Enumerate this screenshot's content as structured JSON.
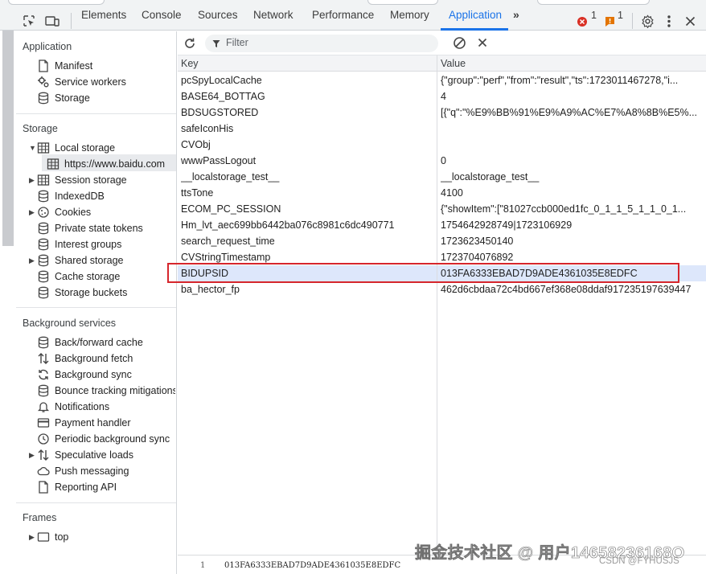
{
  "top_tabs": [
    "Elements",
    "Console",
    "Sources",
    "Network",
    "Performance",
    "Memory",
    "Application"
  ],
  "active_tab": "Application",
  "error_count": "1",
  "warning_count": "1",
  "toolbar": {
    "filter_placeholder": "Filter"
  },
  "sidebar": {
    "application_header": "Application",
    "application_items": [
      "Manifest",
      "Service workers",
      "Storage"
    ],
    "storage_header": "Storage",
    "storage_items": [
      "Local storage",
      "https://www.baidu.com",
      "Session storage",
      "IndexedDB",
      "Cookies",
      "Private state tokens",
      "Interest groups",
      "Shared storage",
      "Cache storage",
      "Storage buckets"
    ],
    "background_header": "Background services",
    "background_items": [
      "Back/forward cache",
      "Background fetch",
      "Background sync",
      "Bounce tracking mitigations",
      "Notifications",
      "Payment handler",
      "Periodic background sync",
      "Speculative loads",
      "Push messaging",
      "Reporting API"
    ],
    "frames_header": "Frames",
    "frames_items": [
      "top"
    ]
  },
  "table": {
    "key_header": "Key",
    "value_header": "Value",
    "rows": [
      {
        "key": "pcSpyLocalCache",
        "value": "{\"group\":\"perf\",\"from\":\"result\",\"ts\":1723011467278,\"i..."
      },
      {
        "key": "BASE64_BOTTAG",
        "value": "4"
      },
      {
        "key": "BDSUGSTORED",
        "value": "[{\"q\":\"%E9%BB%91%E9%A9%AC%E7%A8%8B%E5%..."
      },
      {
        "key": "safeIconHis",
        "value": ""
      },
      {
        "key": "CVObj",
        "value": ""
      },
      {
        "key": "wwwPassLogout",
        "value": "0"
      },
      {
        "key": "__localstorage_test__",
        "value": "__localstorage_test__"
      },
      {
        "key": "ttsTone",
        "value": "4100"
      },
      {
        "key": "ECOM_PC_SESSION",
        "value": "{\"showItem\":[\"81027ccb000ed1fc_0_1_1_5_1_1_0_1..."
      },
      {
        "key": "Hm_lvt_aec699bb6442ba076c8981c6dc490771",
        "value": "1754642928749|1723106929"
      },
      {
        "key": "search_request_time",
        "value": "1723623450140"
      },
      {
        "key": "CVStringTimestamp",
        "value": "1723704076892"
      },
      {
        "key": "BIDUPSID",
        "value": "013FA6333EBAD7D9ADE4361035E8EDFC"
      },
      {
        "key": "ba_hector_fp",
        "value": "462d6cbdaa72c4bd667ef368e08ddaf917235197639447"
      }
    ],
    "selected_key": "BIDUPSID"
  },
  "preview": {
    "line_number": "1",
    "value": "013FA6333EBAD7D9ADE4361035E8EDFC"
  },
  "watermark": {
    "main": "掘金技术社区 @ 用户14658236168O",
    "sub": "CSDN @FYHUSJS"
  }
}
